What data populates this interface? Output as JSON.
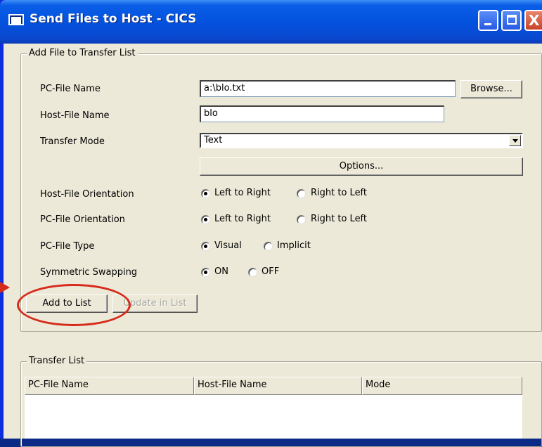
{
  "window": {
    "title": "Send Files to Host - CICS",
    "close_glyph": "X"
  },
  "add_group": {
    "legend": "Add File to Transfer List",
    "pc_file_label": "PC-File Name",
    "pc_file_value": "a:\\blo.txt",
    "browse_label": "Browse...",
    "host_file_label": "Host-File Name",
    "host_file_value": "blo",
    "transfer_mode_label": "Transfer Mode",
    "transfer_mode_value": "Text",
    "options_label": "Options...",
    "host_orientation_label": "Host-File Orientation",
    "host_orientation_options": [
      "Left to Right",
      "Right to Left"
    ],
    "host_orientation_selected": "Left to Right",
    "pc_orientation_label": "PC-File Orientation",
    "pc_orientation_options": [
      "Left to Right",
      "Right to Left"
    ],
    "pc_orientation_selected": "Left to Right",
    "pc_file_type_label": "PC-File Type",
    "pc_file_type_options": [
      "Visual",
      "Implicit"
    ],
    "pc_file_type_selected": "Visual",
    "symmetric_swapping_label": "Symmetric Swapping",
    "symmetric_swapping_options": [
      "ON",
      "OFF"
    ],
    "symmetric_swapping_selected": "ON",
    "add_to_list_label": "Add to List",
    "update_in_list_label": "Update in List"
  },
  "transfer_group": {
    "legend": "Transfer List",
    "columns": [
      "PC-File Name",
      "Host-File Name",
      "Mode"
    ]
  },
  "colors": {
    "annotation_red": "#d62a1a",
    "titlebar_blue": "#0352de",
    "dialog_face": "#ece9d8"
  }
}
